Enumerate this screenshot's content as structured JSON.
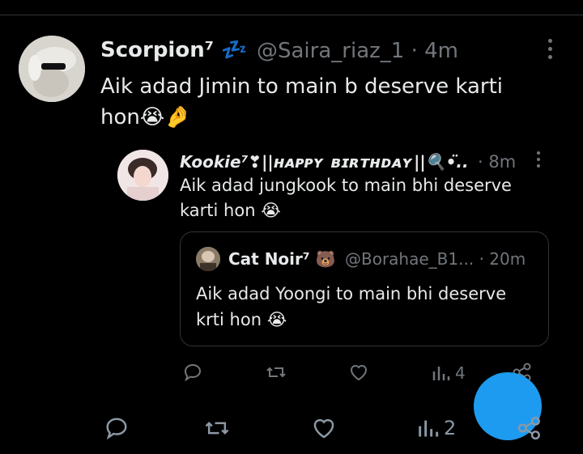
{
  "main_tweet": {
    "display_name": "Scorpion⁷",
    "name_emoji": "💤",
    "handle": "@Saira_riaz_1",
    "separator": "·",
    "time": "4m",
    "text_line1": "Aik adad Jimin to main b deserve karti",
    "text_line2": "hon",
    "text_emojis": "😭🤌",
    "actions": {
      "views_count": "2"
    }
  },
  "reply_tweet": {
    "display_name": "Kookie⁷❣||ʜᴀᴘᴘʏ ʙɪʀᴛʜᴅᴀʏ||🔍•̈..",
    "separator": "·",
    "time": "8m",
    "text_line1": "Aik adad jungkook to main bhi deserve",
    "text_line2": "karti hon",
    "text_emoji": "😭",
    "actions": {
      "views_count": "4"
    }
  },
  "quoted_tweet": {
    "display_name": "Cat Noir⁷",
    "name_emoji": "🐻",
    "handle": "@Borahae_B1...",
    "separator": "·",
    "time": "20m",
    "text_line1": "Aik adad Yoongi to main bhi deserve",
    "text_line2": "krti hon",
    "text_emoji": "😭"
  },
  "colors": {
    "background": "#000000",
    "text": "#e7e9ea",
    "muted": "#71767b",
    "divider": "#2f3336",
    "accent": "#1d9bf0"
  }
}
